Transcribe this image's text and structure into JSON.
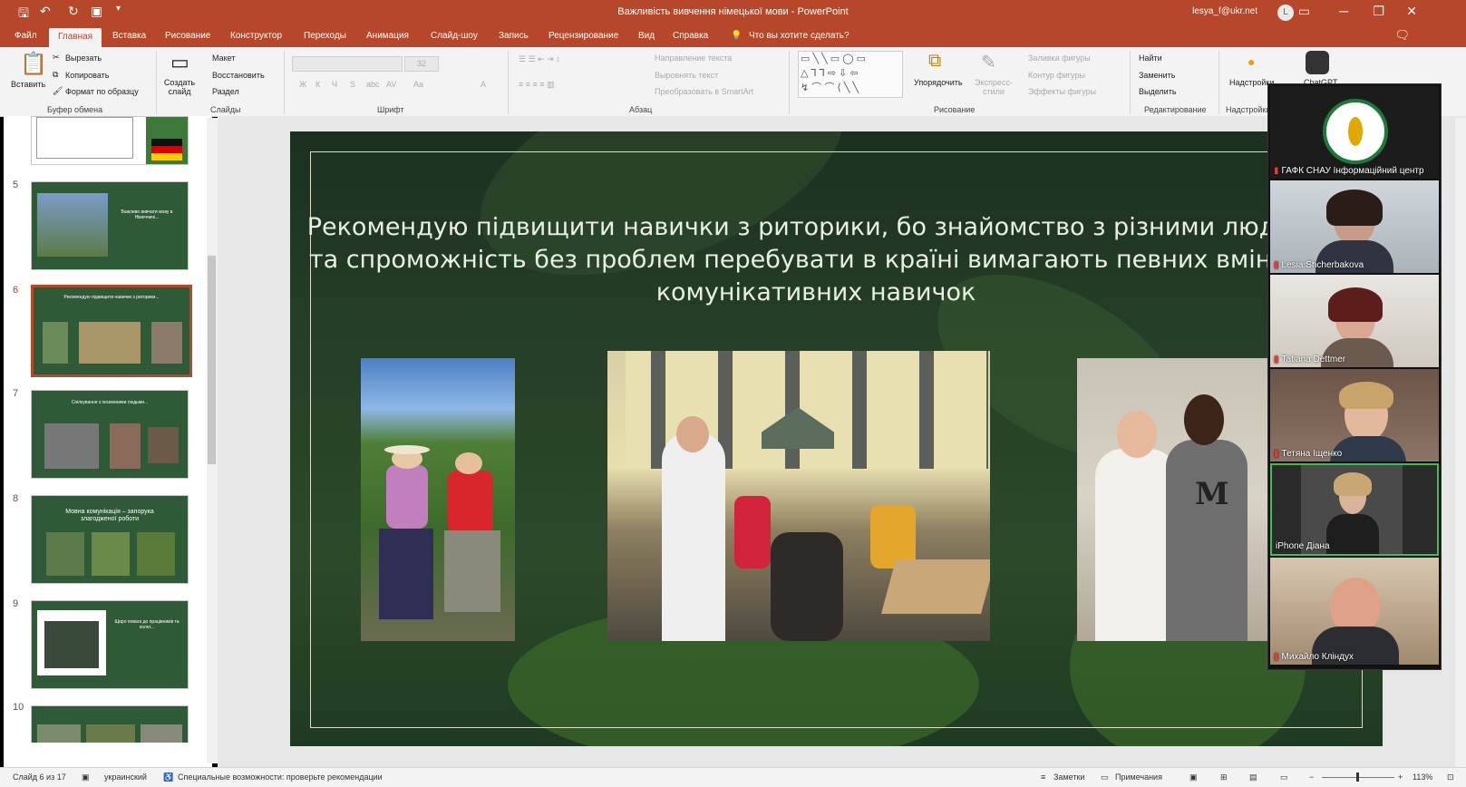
{
  "window": {
    "title": "Важливість вивчення німецької мови - PowerPoint",
    "user": "lesya_f@ukr.net",
    "avatar": "L",
    "quick_access": [
      "save-icon",
      "undo-icon",
      "redo-icon",
      "start-slideshow-icon",
      "customize-icon"
    ]
  },
  "tabs": [
    "Файл",
    "Главная",
    "Вставка",
    "Рисование",
    "Конструктор",
    "Переходы",
    "Анимация",
    "Слайд-шоу",
    "Запись",
    "Рецензирование",
    "Вид",
    "Справка"
  ],
  "tell_me": "Что вы хотите сделать?",
  "ribbon": {
    "clipboard": {
      "paste": "Вставить",
      "cut": "Вырезать",
      "copy": "Копировать",
      "format_painter": "Формат по образцу",
      "group": "Буфер обмена"
    },
    "slides": {
      "new_slide": "Создать слайд",
      "layout": "Макет",
      "reset": "Восстановить",
      "section": "Раздел",
      "group": "Слайды"
    },
    "font": {
      "name": "",
      "size": "32",
      "group": "Шрифт",
      "buttons": [
        "Ж",
        "К",
        "Ч",
        "S",
        "abc",
        "AV",
        "Aa",
        "A"
      ]
    },
    "paragraph": {
      "text_direction": "Направление текста",
      "align_text": "Выровнять текст",
      "smartart": "Преобразовать в SmartArt",
      "group": "Абзац"
    },
    "drawing": {
      "arrange": "Упорядочить",
      "quick_styles": "Экспресс-стили",
      "fill": "Заливка фигуры",
      "outline": "Контур фигуры",
      "effects": "Эффекты фигуры",
      "group": "Рисование"
    },
    "editing": {
      "find": "Найти",
      "replace": "Заменить",
      "select": "Выделить",
      "group": "Редактирование"
    },
    "addins": {
      "label": "Надстройки",
      "group": "Надстройки"
    },
    "chatgpt": "ChatGPT"
  },
  "thumbnails": [
    {
      "num": "5",
      "text": "Важливо вивчати мову в Німеччині..."
    },
    {
      "num": "6",
      "text": "Рекомендую підвищити навички з риторики..."
    },
    {
      "num": "7",
      "text": "Спілкування з іноземними людьми..."
    },
    {
      "num": "8",
      "text": "Мовна комунікація – запорука злагодженої роботи"
    },
    {
      "num": "9",
      "text": "Щиро повага до працівників та колег..."
    },
    {
      "num": "10",
      "text": ""
    }
  ],
  "slide": {
    "title": "Рекомендую підвищити навички з риторики, бо знайомство з різними людьми та спроможність без проблем перебувати в країні вимагають певних вмінь та комунікативних навичок"
  },
  "participants": [
    {
      "name": "ГАФК СНАУ Інформаційний центр",
      "muted": true
    },
    {
      "name": "Lesia Shcherbakova",
      "muted": true
    },
    {
      "name": "Tatiana Dettmer",
      "muted": true
    },
    {
      "name": "Тетяна Іщенко",
      "muted": true
    },
    {
      "name": "iPhone Діана",
      "muted": false,
      "active": true
    },
    {
      "name": "Михайло Кліндух",
      "muted": true
    }
  ],
  "status": {
    "slide_of": "Слайд 6 из 17",
    "language": "украинский",
    "accessibility": "Специальные возможности: проверьте рекомендации",
    "notes": "Заметки",
    "comments": "Примечания",
    "zoom": "113%"
  },
  "colors": {
    "accent": "#b7472a",
    "slide_bg": "#2b4a2a",
    "active_speaker": "#38c150",
    "muted": "#e53935"
  }
}
